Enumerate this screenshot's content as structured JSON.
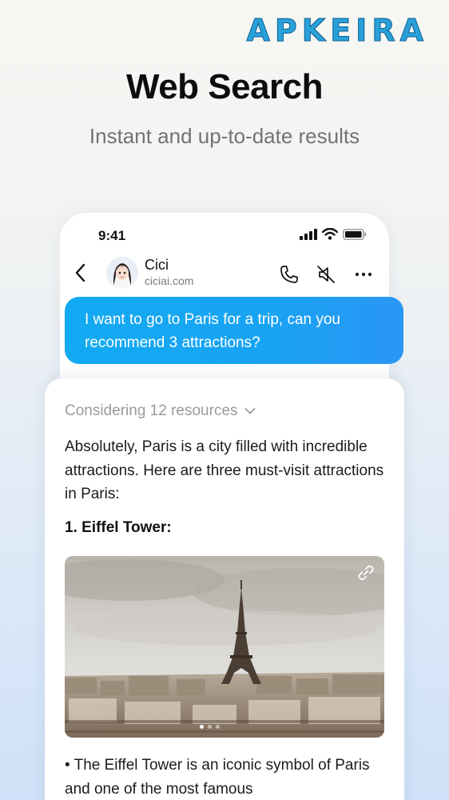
{
  "watermark": "APKEIRA",
  "promo": {
    "title": "Web Search",
    "subtitle": "Instant and up-to-date results"
  },
  "status_bar": {
    "time": "9:41",
    "icons": [
      "signal-icon",
      "wifi-icon",
      "battery-icon"
    ]
  },
  "chat_header": {
    "name": "Cici",
    "subtitle": "ciciai.com",
    "icons": [
      "back-icon",
      "phone-icon",
      "speaker-muted-icon",
      "more-icon"
    ]
  },
  "user_message": "I want to go to Paris for a trip, can you recommend 3 attractions?",
  "response": {
    "sources_label": "Considering 12 resources",
    "intro": "Absolutely, Paris is a city filled with incredible attractions. Here are three must-visit attractions in Paris:",
    "item_title": "1. Eiffel Tower:",
    "image_alt": "Eiffel Tower photo over Paris rooftops",
    "carousel": {
      "count": 3,
      "active": 1
    },
    "item_text": "• The Eiffel Tower is an iconic symbol of Paris and one of the most famous"
  },
  "colors": {
    "bubble": "#19a3f3",
    "watermark": "#2aa0d8",
    "muted_text": "#9a9a9a"
  }
}
